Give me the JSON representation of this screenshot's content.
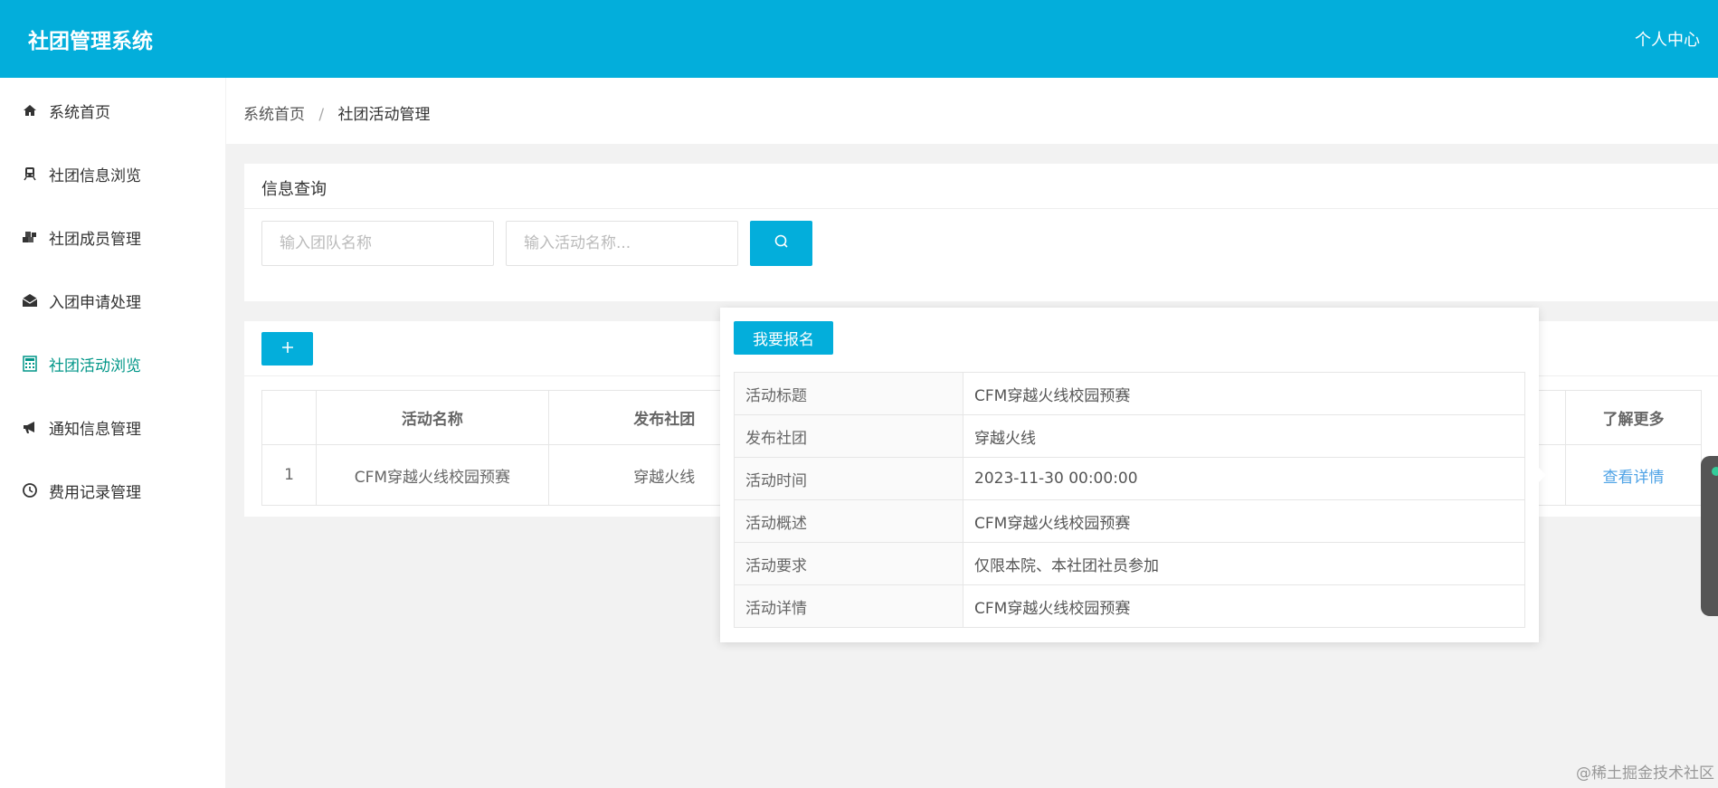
{
  "header": {
    "app_title": "社团管理系统",
    "personal_center": "个人中心"
  },
  "sidebar": {
    "items": [
      {
        "label": "系统首页",
        "icon": "home-icon",
        "active": false
      },
      {
        "label": "社团信息浏览",
        "icon": "train-icon",
        "active": false
      },
      {
        "label": "社团成员管理",
        "icon": "cubes-icon",
        "active": false
      },
      {
        "label": "入团申请处理",
        "icon": "envelope-open-icon",
        "active": false
      },
      {
        "label": "社团活动浏览",
        "icon": "calculator-icon",
        "active": true
      },
      {
        "label": "通知信息管理",
        "icon": "bullhorn-icon",
        "active": false
      },
      {
        "label": "费用记录管理",
        "icon": "clock-icon",
        "active": false
      }
    ]
  },
  "breadcrumb": {
    "home": "系统首页",
    "separator": "/",
    "current": "社团活动管理"
  },
  "query": {
    "title": "信息查询",
    "team_placeholder": "输入团队名称",
    "activity_placeholder": "输入活动名称...",
    "search_icon": "search-icon"
  },
  "table": {
    "add_icon": "plus-icon",
    "headers": [
      "",
      "活动名称",
      "发布社团",
      "了解更多"
    ],
    "rows": [
      {
        "index": "1",
        "name": "CFM穿越火线校园预赛",
        "club": "穿越火线",
        "more": "查看详情"
      }
    ]
  },
  "popup": {
    "signup_button": "我要报名",
    "fields": [
      {
        "key": "活动标题",
        "value": "CFM穿越火线校园预赛"
      },
      {
        "key": "发布社团",
        "value": "穿越火线"
      },
      {
        "key": "活动时间",
        "value": "2023-11-30 00:00:00"
      },
      {
        "key": "活动概述",
        "value": "CFM穿越火线校园预赛"
      },
      {
        "key": "活动要求",
        "value": "仅限本院、本社团社员参加"
      },
      {
        "key": "活动详情",
        "value": "CFM穿越火线校园预赛"
      }
    ]
  },
  "watermark": "@稀土掘金技术社区",
  "colors": {
    "header_bg": "#03aedb",
    "active_menu": "#009688",
    "link": "#4fa3e6"
  }
}
